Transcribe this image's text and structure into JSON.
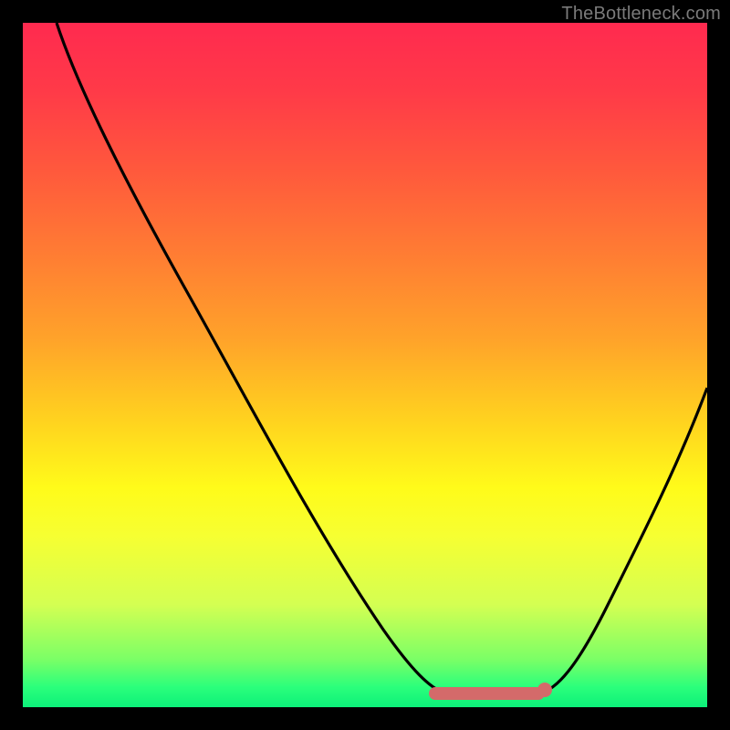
{
  "watermark": "TheBottleneck.com",
  "accent": {
    "marker": "#d46a6a",
    "line": "#000000"
  },
  "chart_data": {
    "type": "line",
    "title": "",
    "xlabel": "",
    "ylabel": "",
    "xlim": [
      0,
      100
    ],
    "ylim": [
      0,
      100
    ],
    "grid": false,
    "series": [
      {
        "name": "bottleneck-curve",
        "x": [
          5,
          10,
          15,
          20,
          25,
          30,
          35,
          40,
          45,
          50,
          55,
          58,
          60,
          63,
          66,
          70,
          73,
          76,
          80,
          85,
          90,
          95,
          100
        ],
        "y": [
          100,
          92,
          82,
          72,
          62,
          52,
          42,
          33,
          25,
          18,
          11,
          7,
          5,
          3,
          2,
          2,
          2,
          3,
          5,
          12,
          22,
          34,
          47
        ]
      }
    ],
    "markers": [
      {
        "name": "sweet-spot-start",
        "x": 60,
        "y": 3,
        "style": "round-cap"
      },
      {
        "name": "sweet-spot-end",
        "x": 76,
        "y": 3,
        "style": "dot"
      }
    ],
    "sweet_spot_band": {
      "x0": 60,
      "x1": 76,
      "y": 2.5
    }
  }
}
